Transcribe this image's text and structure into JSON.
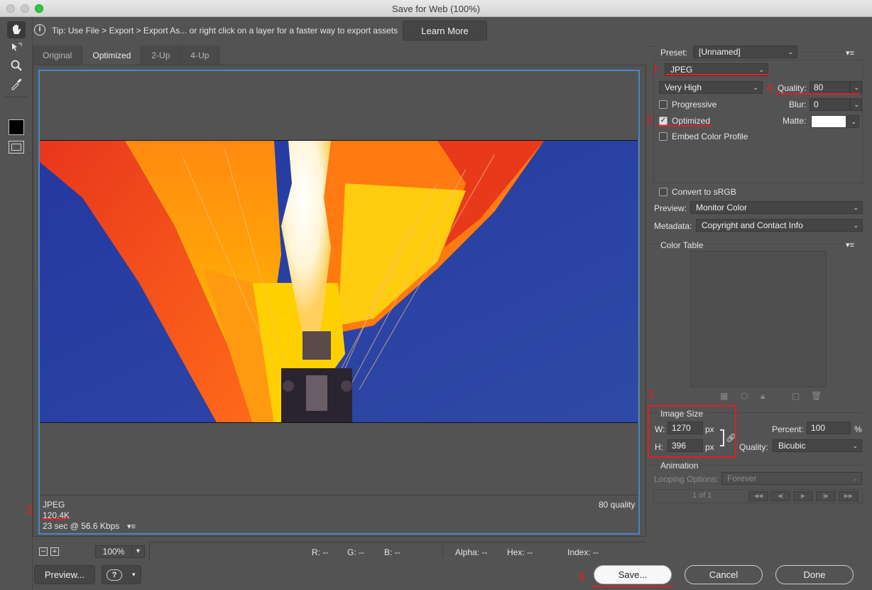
{
  "window": {
    "title": "Save for Web (100%)"
  },
  "tip": {
    "text": "Tip: Use File > Export > Export As...  or right click on a layer for a faster way to export assets",
    "learn_more": "Learn More"
  },
  "tabs": [
    "Original",
    "Optimized",
    "2-Up",
    "4-Up"
  ],
  "tools": [
    "hand-tool-icon",
    "slice-select-icon",
    "zoom-icon",
    "eyedropper-icon"
  ],
  "preview_info": {
    "format": "JPEG",
    "size": "120.4K",
    "time": "23 sec @ 56.6 Kbps",
    "quality": "80 quality",
    "menu": "▾≡"
  },
  "status": {
    "zoom": "100%",
    "r": "R: --",
    "g": "G: --",
    "b": "B: --",
    "alpha": "Alpha: --",
    "hex": "Hex: --",
    "index": "Index: --"
  },
  "buttons": {
    "preview": "Preview...",
    "save": "Save...",
    "cancel": "Cancel",
    "done": "Done",
    "help": "?"
  },
  "panel": {
    "preset_label": "Preset:",
    "preset_value": "[Unnamed]",
    "format": "JPEG",
    "compression": "Very High",
    "quality_label": "Quality:",
    "quality_value": "80",
    "progressive": "Progressive",
    "blur_label": "Blur:",
    "blur_value": "0",
    "optimized": "Optimized",
    "matte_label": "Matte:",
    "embed_profile": "Embed Color Profile",
    "convert_srgb": "Convert to sRGB",
    "preview_label": "Preview:",
    "preview_value": "Monitor Color",
    "metadata_label": "Metadata:",
    "metadata_value": "Copyright and Contact Info",
    "color_table": "Color Table",
    "image_size": "Image Size",
    "w_label": "W:",
    "w_value": "1270",
    "h_label": "H:",
    "h_value": "396",
    "px": "px",
    "percent_label": "Percent:",
    "percent_value": "100",
    "percent_unit": "%",
    "resample_label": "Quality:",
    "resample_value": "Bicubic",
    "animation": "Animation",
    "looping_label": "Looping Options:",
    "looping_value": "Forever",
    "frame_count": "1 of 1"
  },
  "annotations": [
    "1",
    "2",
    "3",
    "4",
    "5",
    "6"
  ],
  "colors": {
    "accent": "#4a86c8",
    "annotation": "#e02020",
    "sky": "#2a3f9e"
  }
}
